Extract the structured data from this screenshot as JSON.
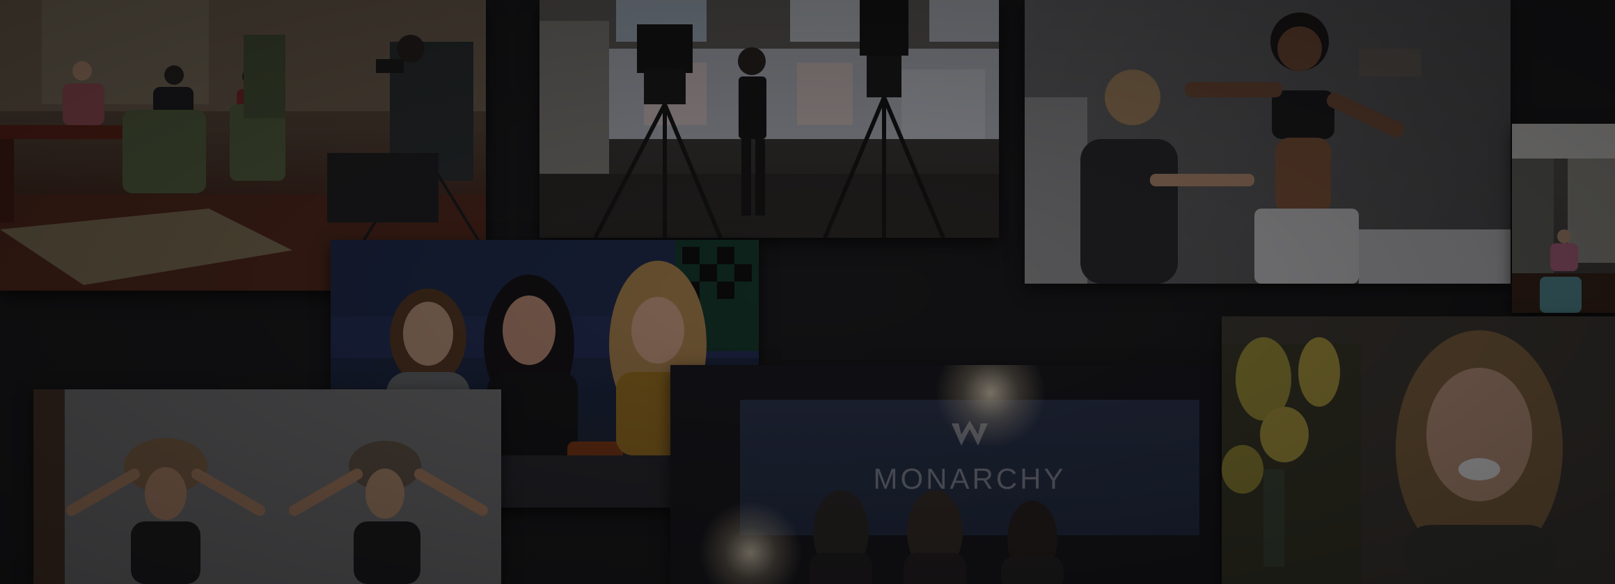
{
  "collage": {
    "tiles": [
      {
        "id": "office-interview"
      },
      {
        "id": "studio-tripods"
      },
      {
        "id": "fitting"
      },
      {
        "id": "small-interview"
      },
      {
        "id": "three-friends"
      },
      {
        "id": "hats"
      },
      {
        "id": "monarchy-stage",
        "sign_text": "MONARCHY"
      },
      {
        "id": "smiling-woman"
      }
    ]
  },
  "colors": {
    "background": "#121214",
    "overlay": "rgba(10,10,12,0.42)"
  }
}
